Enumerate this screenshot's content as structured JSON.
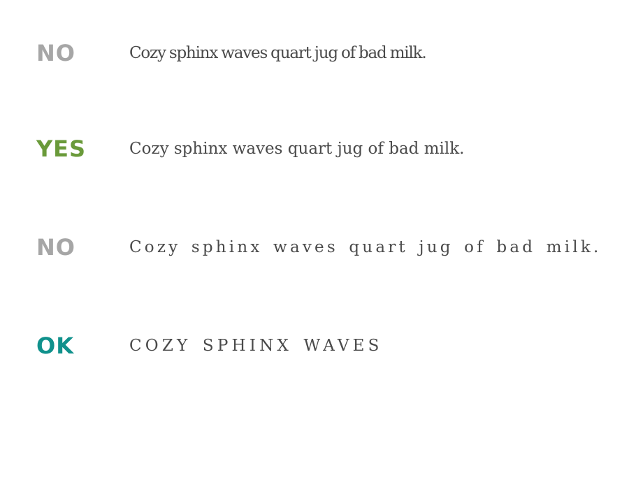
{
  "colors": {
    "no": "#a6a6a6",
    "yes": "#6a9a3a",
    "ok": "#10918c",
    "sample_text": "#4a4a4a"
  },
  "rows": [
    {
      "verdict": "NO",
      "sample": "Cozy sphinx waves quart jug of bad milk."
    },
    {
      "verdict": "YES",
      "sample": "Cozy sphinx waves quart jug of bad milk."
    },
    {
      "verdict": "NO",
      "sample": "Cozy sphinx waves quart jug of bad milk."
    },
    {
      "verdict": "OK",
      "sample": "COZY SPHINX WAVES"
    }
  ]
}
